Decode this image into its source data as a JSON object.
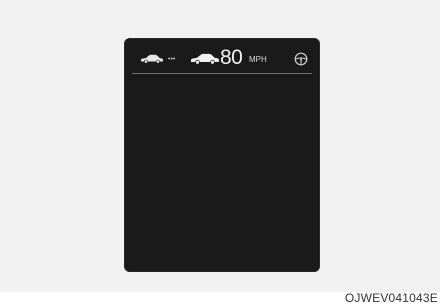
{
  "cluster": {
    "speed_value": "80",
    "speed_unit": "MPH",
    "gap_indicator": "•••",
    "icons": {
      "lead_vehicle": "car-icon",
      "own_vehicle": "car-icon",
      "status": "steering-wheel-icon"
    }
  },
  "figure": {
    "caption": "OJWEV041043E"
  },
  "colors": {
    "display_background": "#1a1a1a",
    "text": "#f2f2f2",
    "page_background": "#f1f1f1"
  }
}
